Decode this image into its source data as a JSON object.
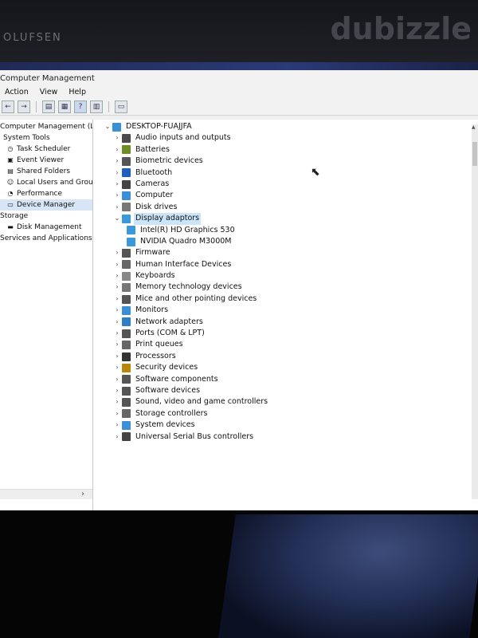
{
  "photo": {
    "brand": "OLUFSEN",
    "watermark": "dubizzle"
  },
  "window": {
    "title": "Computer Management"
  },
  "menu": [
    "Action",
    "View",
    "Help"
  ],
  "toolbar": [
    {
      "name": "back-icon",
      "glyph": "←"
    },
    {
      "name": "forward-icon",
      "glyph": "→"
    },
    {
      "name": "folder-icon",
      "glyph": "▤"
    },
    {
      "name": "properties-icon",
      "glyph": "▦"
    },
    {
      "name": "help-icon",
      "glyph": "?"
    },
    {
      "name": "show-hide-icon",
      "glyph": "▥"
    },
    {
      "name": "monitor-icon",
      "glyph": "▭"
    }
  ],
  "left_tree": [
    {
      "label": "Computer Management (Local",
      "indent": 0,
      "icon": "computer-management-icon",
      "glyph": ""
    },
    {
      "label": "System Tools",
      "indent": 4,
      "icon": "system-tools-icon",
      "glyph": ""
    },
    {
      "label": "Task Scheduler",
      "indent": 8,
      "icon": "clock-icon",
      "glyph": "◷"
    },
    {
      "label": "Event Viewer",
      "indent": 8,
      "icon": "event-viewer-icon",
      "glyph": "▣"
    },
    {
      "label": "Shared Folders",
      "indent": 8,
      "icon": "shared-folder-icon",
      "glyph": "▤"
    },
    {
      "label": "Local Users and Groups",
      "indent": 8,
      "icon": "users-icon",
      "glyph": "☺"
    },
    {
      "label": "Performance",
      "indent": 8,
      "icon": "performance-icon",
      "glyph": "◔"
    },
    {
      "label": "Device Manager",
      "indent": 8,
      "icon": "device-manager-icon",
      "glyph": "▭",
      "selected": true
    },
    {
      "label": "Storage",
      "indent": 0,
      "icon": "storage-icon",
      "glyph": ""
    },
    {
      "label": "Disk Management",
      "indent": 8,
      "icon": "disk-management-icon",
      "glyph": "▬"
    },
    {
      "label": "Services and Applications",
      "indent": 0,
      "icon": "services-icon",
      "glyph": ""
    }
  ],
  "device_tree": {
    "root": "DESKTOP-FUAJJFA",
    "items": [
      {
        "label": "Audio inputs and outputs",
        "icon": "speaker-icon",
        "color": "#4a4a4a",
        "expanded": false
      },
      {
        "label": "Batteries",
        "icon": "battery-icon",
        "color": "#6b8e23",
        "expanded": false
      },
      {
        "label": "Biometric devices",
        "icon": "biometric-icon",
        "color": "#555555",
        "expanded": false
      },
      {
        "label": "Bluetooth",
        "icon": "bluetooth-icon",
        "color": "#1f5fbf",
        "expanded": false
      },
      {
        "label": "Cameras",
        "icon": "camera-icon",
        "color": "#444444",
        "expanded": false
      },
      {
        "label": "Computer",
        "icon": "computer-icon",
        "color": "#3b8fd6",
        "expanded": false
      },
      {
        "label": "Disk drives",
        "icon": "disk-drive-icon",
        "color": "#777777",
        "expanded": false
      },
      {
        "label": "Display adaptors",
        "icon": "display-adapter-icon",
        "color": "#3a9ad9",
        "expanded": true,
        "selected": true
      },
      {
        "label": "Intel(R) HD Graphics 530",
        "icon": "display-adapter-icon",
        "color": "#3a9ad9",
        "child": true
      },
      {
        "label": "NVIDIA Quadro M3000M",
        "icon": "display-adapter-icon",
        "color": "#3a9ad9",
        "child": true
      },
      {
        "label": "Firmware",
        "icon": "firmware-icon",
        "color": "#555555",
        "expanded": false
      },
      {
        "label": "Human Interface Devices",
        "icon": "hid-icon",
        "color": "#666666",
        "expanded": false
      },
      {
        "label": "Keyboards",
        "icon": "keyboard-icon",
        "color": "#888888",
        "expanded": false
      },
      {
        "label": "Memory technology devices",
        "icon": "memory-icon",
        "color": "#777777",
        "expanded": false
      },
      {
        "label": "Mice and other pointing devices",
        "icon": "mouse-icon",
        "color": "#555555",
        "expanded": false
      },
      {
        "label": "Monitors",
        "icon": "monitor-icon",
        "color": "#3a8fd6",
        "expanded": false
      },
      {
        "label": "Network adapters",
        "icon": "network-adapter-icon",
        "color": "#2f7fc6",
        "expanded": false
      },
      {
        "label": "Ports (COM & LPT)",
        "icon": "port-icon",
        "color": "#555555",
        "expanded": false
      },
      {
        "label": "Print queues",
        "icon": "printer-icon",
        "color": "#666666",
        "expanded": false
      },
      {
        "label": "Processors",
        "icon": "processor-icon",
        "color": "#333333",
        "expanded": false
      },
      {
        "label": "Security devices",
        "icon": "security-icon",
        "color": "#b8860b",
        "expanded": false
      },
      {
        "label": "Software components",
        "icon": "software-component-icon",
        "color": "#555555",
        "expanded": false
      },
      {
        "label": "Software devices",
        "icon": "software-device-icon",
        "color": "#555555",
        "expanded": false
      },
      {
        "label": "Sound, video and game controllers",
        "icon": "sound-icon",
        "color": "#555555",
        "expanded": false
      },
      {
        "label": "Storage controllers",
        "icon": "storage-controller-icon",
        "color": "#666666",
        "expanded": false
      },
      {
        "label": "System devices",
        "icon": "system-device-icon",
        "color": "#3a8fd6",
        "expanded": false
      },
      {
        "label": "Universal Serial Bus controllers",
        "icon": "usb-icon",
        "color": "#444444",
        "expanded": false
      }
    ]
  }
}
